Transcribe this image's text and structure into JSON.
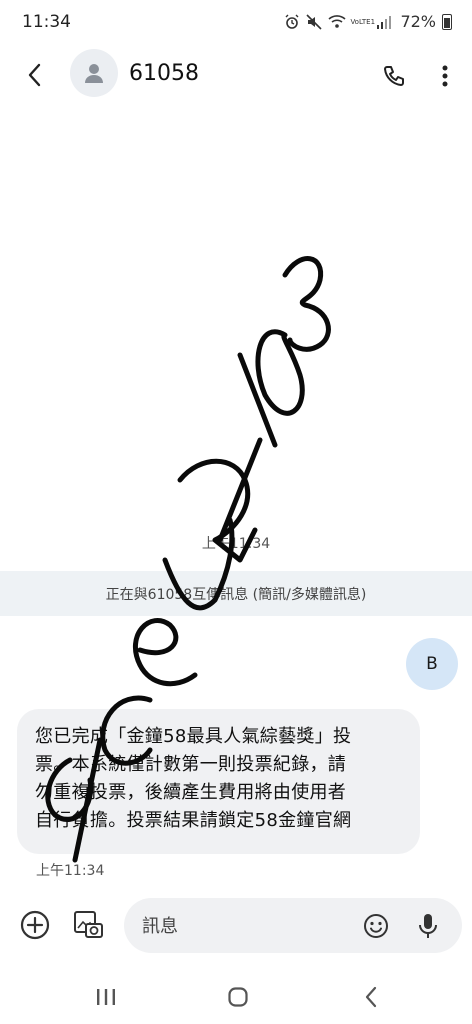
{
  "status_bar": {
    "time": "11:34",
    "network_label": "VoLTE1",
    "battery": "72%"
  },
  "header": {
    "contact_name": "61058",
    "back_icon": "arrow-back-icon",
    "avatar_icon": "person-icon",
    "call_icon": "phone-icon",
    "more_icon": "more-vert-icon"
  },
  "conversation": {
    "timestamp": "上午11:34",
    "info_banner": "正在與61058互傳訊息 (簡訊/多媒體訊息)",
    "sent_message": {
      "text": "B"
    },
    "received_message": {
      "lines": [
        "您已完成「金鐘58最具人氣綜藝獎」投",
        "票。本系統僅計數第一則投票紀錄，請",
        "勿重複投票，後續產生費用將由使用者",
        "自行負擔。投票結果請鎖定58金鐘官網"
      ],
      "time": "上午11:34"
    }
  },
  "composer": {
    "placeholder": "訊息",
    "plus_icon": "add-circle-icon",
    "gallery_icon": "gallery-camera-icon",
    "emoji_icon": "emoji-icon",
    "mic_icon": "mic-icon"
  },
  "navbar": {
    "recent_icon": "recent-apps-icon",
    "home_icon": "home-icon",
    "back_icon": "nav-back-icon"
  },
  "overlay": {
    "handwriting": "dcev 2/103"
  }
}
